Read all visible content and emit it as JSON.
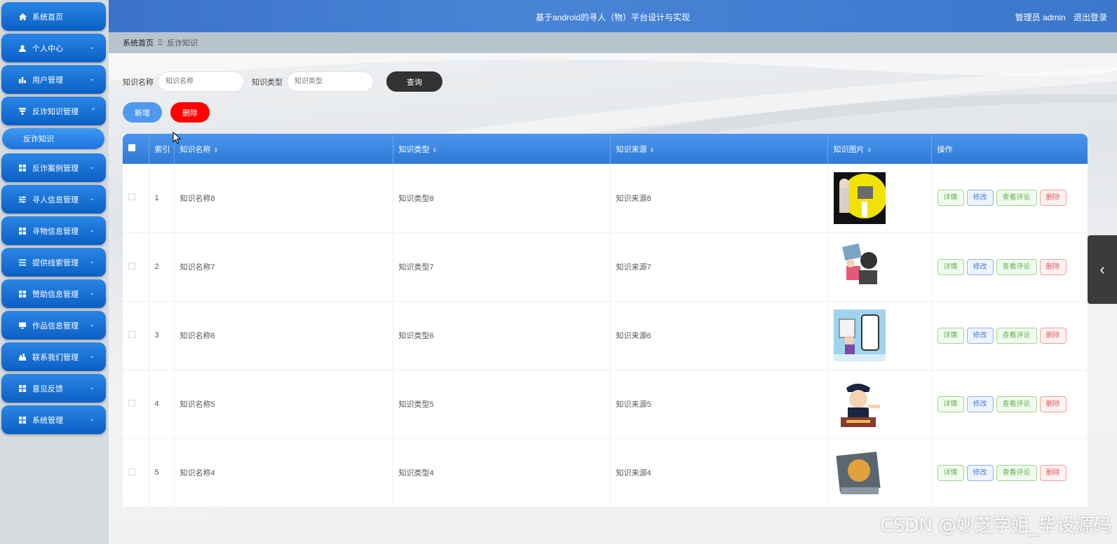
{
  "header": {
    "title": "基于android的寻人（物）平台设计与实现",
    "user_label": "管理员 admin",
    "logout_label": "退出登录"
  },
  "sidebar": {
    "items": [
      {
        "label": "系统首页",
        "icon": "home-icon",
        "has_children": false
      },
      {
        "label": "个人中心",
        "icon": "person-icon",
        "has_children": true
      },
      {
        "label": "用户管理",
        "icon": "bar-chart-icon",
        "has_children": true
      },
      {
        "label": "反诈知识管理",
        "icon": "filter-icon",
        "has_children": true,
        "expanded": true
      },
      {
        "label": "反诈案例管理",
        "icon": "grid-icon",
        "has_children": true
      },
      {
        "label": "寻人信息管理",
        "icon": "sliders-icon",
        "has_children": true
      },
      {
        "label": "寻物信息管理",
        "icon": "grid-icon",
        "has_children": true
      },
      {
        "label": "提供线索管理",
        "icon": "list-icon",
        "has_children": true
      },
      {
        "label": "赞助信息管理",
        "icon": "grid-icon",
        "has_children": true
      },
      {
        "label": "作品信息管理",
        "icon": "monitor-icon",
        "has_children": true
      },
      {
        "label": "联系我们管理",
        "icon": "chart-icon",
        "has_children": true
      },
      {
        "label": "意见反馈",
        "icon": "grid-icon",
        "has_children": true
      },
      {
        "label": "系统管理",
        "icon": "grid-icon",
        "has_children": true
      }
    ],
    "submenu_active": "反诈知识"
  },
  "breadcrumb": {
    "home": "系统首页",
    "separator": "Ξ",
    "current": "反诈知识"
  },
  "search": {
    "name_label": "知识名称",
    "name_placeholder": "知识名称",
    "type_label": "知识类型",
    "type_placeholder": "知识类型",
    "query_button": "查询"
  },
  "actions": {
    "add_button": "新增",
    "delete_button": "删除"
  },
  "table": {
    "headers": {
      "index": "索引",
      "name": "知识名称",
      "type": "知识类型",
      "source": "知识来源",
      "image": "知识图片",
      "ops": "操作"
    },
    "rows": [
      {
        "index": "1",
        "name": "知识名称8",
        "type": "知识类型8",
        "source": "知识来源8"
      },
      {
        "index": "2",
        "name": "知识名称7",
        "type": "知识类型7",
        "source": "知识来源7"
      },
      {
        "index": "3",
        "name": "知识名称6",
        "type": "知识类型6",
        "source": "知识来源6"
      },
      {
        "index": "4",
        "name": "知识名称5",
        "type": "知识类型5",
        "source": "知识来源5"
      },
      {
        "index": "5",
        "name": "知识名称4",
        "type": "知识类型4",
        "source": "知识来源4"
      }
    ],
    "op_labels": {
      "detail": "详情",
      "edit": "修改",
      "review": "查看评论",
      "remove": "删除"
    }
  },
  "watermark": "CSDN @妙芝学姐_毕设源码",
  "colors": {
    "header_bg": "#3a73c8",
    "menu_bg": "#0b5fc4",
    "table_head": "#3a86e2",
    "query_btn": "#303233",
    "add_btn": "#4f9aee",
    "delete_btn": "#ff0000"
  }
}
